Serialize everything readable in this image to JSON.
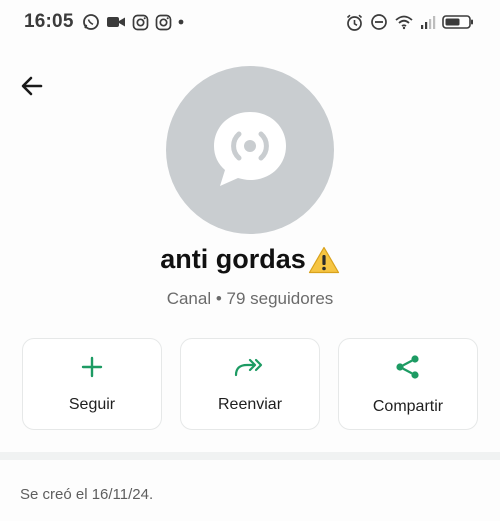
{
  "status_bar": {
    "time": "16:05",
    "left_icons": [
      "whatsapp-icon",
      "video-icon",
      "instagram-icon",
      "instagram-icon",
      "dot-icon"
    ],
    "right_icons": [
      "alarm-icon",
      "do-not-disturb-icon",
      "wifi-icon",
      "signal-icon",
      "battery-icon"
    ]
  },
  "header": {
    "back_icon": "arrow-left-icon"
  },
  "channel": {
    "name": "anti gordas",
    "name_emoji": "warning-icon",
    "meta": "Canal • 79 seguidores",
    "avatar_icon": "channel-broadcast-icon"
  },
  "actions": {
    "follow_label": "Seguir",
    "forward_label": "Reenviar",
    "share_label": "Compartir",
    "accent_color": "#1d9b63"
  },
  "footer": {
    "created_text": "Se creó el 16/11/24."
  }
}
